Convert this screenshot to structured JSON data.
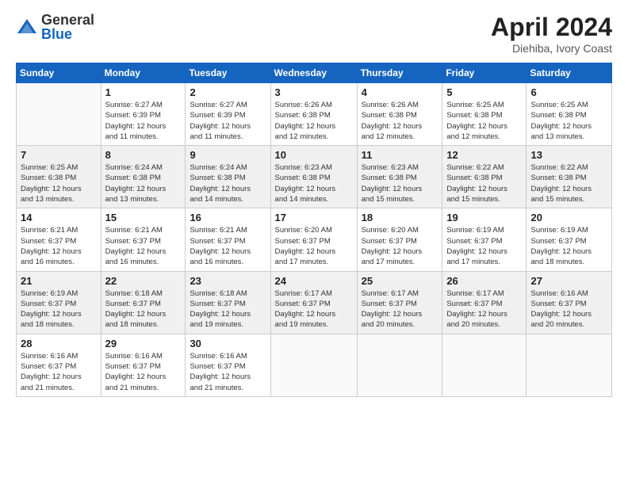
{
  "header": {
    "logo_general": "General",
    "logo_blue": "Blue",
    "title": "April 2024",
    "location": "Diehiba, Ivory Coast"
  },
  "weekdays": [
    "Sunday",
    "Monday",
    "Tuesday",
    "Wednesday",
    "Thursday",
    "Friday",
    "Saturday"
  ],
  "weeks": [
    [
      {
        "day": "",
        "info": ""
      },
      {
        "day": "1",
        "info": "Sunrise: 6:27 AM\nSunset: 6:39 PM\nDaylight: 12 hours\nand 11 minutes."
      },
      {
        "day": "2",
        "info": "Sunrise: 6:27 AM\nSunset: 6:39 PM\nDaylight: 12 hours\nand 11 minutes."
      },
      {
        "day": "3",
        "info": "Sunrise: 6:26 AM\nSunset: 6:38 PM\nDaylight: 12 hours\nand 12 minutes."
      },
      {
        "day": "4",
        "info": "Sunrise: 6:26 AM\nSunset: 6:38 PM\nDaylight: 12 hours\nand 12 minutes."
      },
      {
        "day": "5",
        "info": "Sunrise: 6:25 AM\nSunset: 6:38 PM\nDaylight: 12 hours\nand 12 minutes."
      },
      {
        "day": "6",
        "info": "Sunrise: 6:25 AM\nSunset: 6:38 PM\nDaylight: 12 hours\nand 13 minutes."
      }
    ],
    [
      {
        "day": "7",
        "info": "Sunrise: 6:25 AM\nSunset: 6:38 PM\nDaylight: 12 hours\nand 13 minutes."
      },
      {
        "day": "8",
        "info": "Sunrise: 6:24 AM\nSunset: 6:38 PM\nDaylight: 12 hours\nand 13 minutes."
      },
      {
        "day": "9",
        "info": "Sunrise: 6:24 AM\nSunset: 6:38 PM\nDaylight: 12 hours\nand 14 minutes."
      },
      {
        "day": "10",
        "info": "Sunrise: 6:23 AM\nSunset: 6:38 PM\nDaylight: 12 hours\nand 14 minutes."
      },
      {
        "day": "11",
        "info": "Sunrise: 6:23 AM\nSunset: 6:38 PM\nDaylight: 12 hours\nand 15 minutes."
      },
      {
        "day": "12",
        "info": "Sunrise: 6:22 AM\nSunset: 6:38 PM\nDaylight: 12 hours\nand 15 minutes."
      },
      {
        "day": "13",
        "info": "Sunrise: 6:22 AM\nSunset: 6:38 PM\nDaylight: 12 hours\nand 15 minutes."
      }
    ],
    [
      {
        "day": "14",
        "info": "Sunrise: 6:21 AM\nSunset: 6:37 PM\nDaylight: 12 hours\nand 16 minutes."
      },
      {
        "day": "15",
        "info": "Sunrise: 6:21 AM\nSunset: 6:37 PM\nDaylight: 12 hours\nand 16 minutes."
      },
      {
        "day": "16",
        "info": "Sunrise: 6:21 AM\nSunset: 6:37 PM\nDaylight: 12 hours\nand 16 minutes."
      },
      {
        "day": "17",
        "info": "Sunrise: 6:20 AM\nSunset: 6:37 PM\nDaylight: 12 hours\nand 17 minutes."
      },
      {
        "day": "18",
        "info": "Sunrise: 6:20 AM\nSunset: 6:37 PM\nDaylight: 12 hours\nand 17 minutes."
      },
      {
        "day": "19",
        "info": "Sunrise: 6:19 AM\nSunset: 6:37 PM\nDaylight: 12 hours\nand 17 minutes."
      },
      {
        "day": "20",
        "info": "Sunrise: 6:19 AM\nSunset: 6:37 PM\nDaylight: 12 hours\nand 18 minutes."
      }
    ],
    [
      {
        "day": "21",
        "info": "Sunrise: 6:19 AM\nSunset: 6:37 PM\nDaylight: 12 hours\nand 18 minutes."
      },
      {
        "day": "22",
        "info": "Sunrise: 6:18 AM\nSunset: 6:37 PM\nDaylight: 12 hours\nand 18 minutes."
      },
      {
        "day": "23",
        "info": "Sunrise: 6:18 AM\nSunset: 6:37 PM\nDaylight: 12 hours\nand 19 minutes."
      },
      {
        "day": "24",
        "info": "Sunrise: 6:17 AM\nSunset: 6:37 PM\nDaylight: 12 hours\nand 19 minutes."
      },
      {
        "day": "25",
        "info": "Sunrise: 6:17 AM\nSunset: 6:37 PM\nDaylight: 12 hours\nand 20 minutes."
      },
      {
        "day": "26",
        "info": "Sunrise: 6:17 AM\nSunset: 6:37 PM\nDaylight: 12 hours\nand 20 minutes."
      },
      {
        "day": "27",
        "info": "Sunrise: 6:16 AM\nSunset: 6:37 PM\nDaylight: 12 hours\nand 20 minutes."
      }
    ],
    [
      {
        "day": "28",
        "info": "Sunrise: 6:16 AM\nSunset: 6:37 PM\nDaylight: 12 hours\nand 21 minutes."
      },
      {
        "day": "29",
        "info": "Sunrise: 6:16 AM\nSunset: 6:37 PM\nDaylight: 12 hours\nand 21 minutes."
      },
      {
        "day": "30",
        "info": "Sunrise: 6:16 AM\nSunset: 6:37 PM\nDaylight: 12 hours\nand 21 minutes."
      },
      {
        "day": "",
        "info": ""
      },
      {
        "day": "",
        "info": ""
      },
      {
        "day": "",
        "info": ""
      },
      {
        "day": "",
        "info": ""
      }
    ]
  ]
}
